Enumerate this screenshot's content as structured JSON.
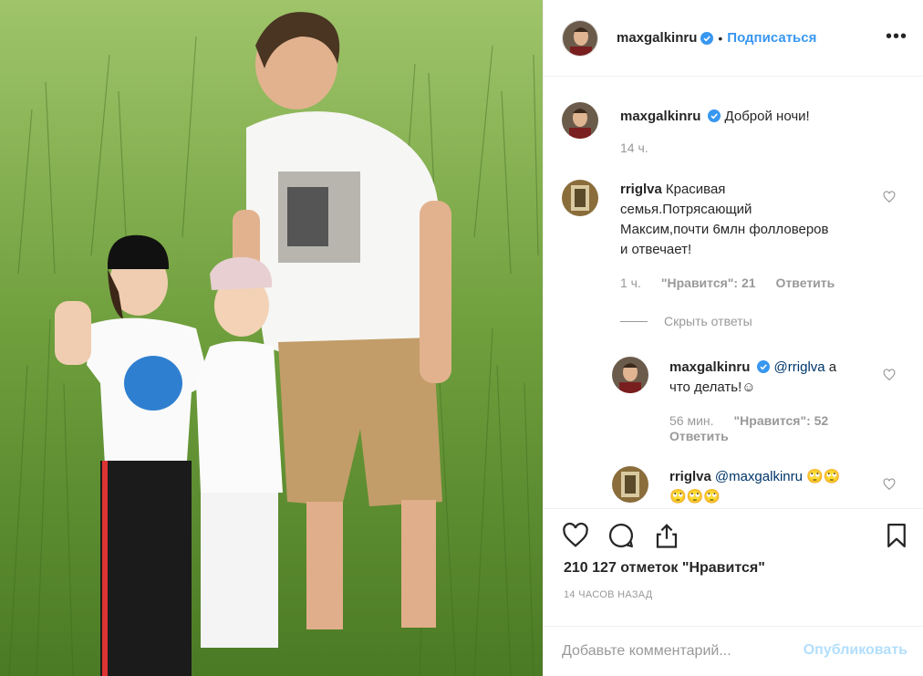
{
  "post": {
    "author": "maxgalkinru",
    "follow_label": "Подписаться",
    "more_label": "•••",
    "caption": "Доброй ночи!",
    "caption_time": "14 ч."
  },
  "comments": [
    {
      "username": "rriglva",
      "text": "Красивая семья.Потрясающий Максим,почти 6млн фолловеров и отвечает!",
      "text_lines": [
        "Красивая",
        "семья.Потрясающий",
        "Максим,почти 6млн фолловеров",
        "и отвечает!"
      ],
      "time": "1 ч.",
      "likes": "\"Нравится\": 21",
      "reply_label": "Ответить"
    }
  ],
  "hide_replies_label": "Скрыть ответы",
  "replies": [
    {
      "username": "maxgalkinru",
      "mention": "@rriglva",
      "text_line1": "а",
      "text_line2": "что делать!☺",
      "time": "56 мин.",
      "likes": "\"Нравится\": 52",
      "reply_label": "Ответить"
    },
    {
      "username": "rriglva",
      "mention": "@maxgalkinru",
      "text_line1": "🙄🙄",
      "text_line2": "🙄🙄🙄"
    }
  ],
  "stats": {
    "likes_text": "210 127 отметок \"Нравится\"",
    "time_ago": "14 ЧАСОВ НАЗАД"
  },
  "comment_box": {
    "placeholder": "Добавьте комментарий...",
    "publish_label": "Опубликовать"
  },
  "colors": {
    "accent": "#3897f0",
    "mention": "#003569",
    "muted": "#999999",
    "publish_disabled": "#b2dffc"
  },
  "icons": [
    "verified-icon",
    "more-icon",
    "heart-icon",
    "comment-icon",
    "share-icon",
    "bookmark-icon"
  ]
}
